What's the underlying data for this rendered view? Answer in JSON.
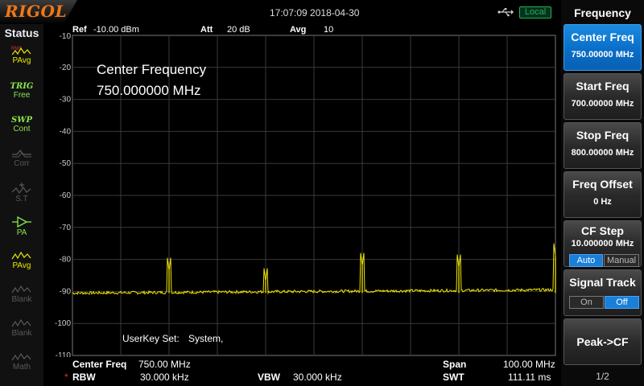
{
  "header": {
    "brand": "RIGOL",
    "datetime": "17:07:09 2018-04-30",
    "remote_badge": "Local",
    "usb_icon": "usb-icon"
  },
  "status_panel": {
    "title": "Status",
    "items": [
      {
        "id": "pavg",
        "tag": "",
        "label": "PAvg",
        "state": "active",
        "icon": "average-trace-icon"
      },
      {
        "id": "trig",
        "tag": "TRIG",
        "label": "Free",
        "state": "green",
        "icon": ""
      },
      {
        "id": "swp",
        "tag": "SWP",
        "label": "Cont",
        "state": "green",
        "icon": ""
      },
      {
        "id": "corr",
        "tag": "",
        "label": "Corr",
        "state": "dim",
        "icon": "correction-icon"
      },
      {
        "id": "st",
        "tag": "",
        "label": "S.T",
        "state": "dim",
        "icon": "spectrum-trace-icon"
      },
      {
        "id": "pa",
        "tag": "",
        "label": "PA",
        "state": "green",
        "icon": "preamp-icon"
      },
      {
        "id": "pavg2",
        "tag": "",
        "label": "PAvg",
        "state": "active",
        "icon": "average-trace-icon"
      },
      {
        "id": "blank1",
        "tag": "",
        "label": "Blank",
        "state": "dim",
        "icon": "trace-icon"
      },
      {
        "id": "blank2",
        "tag": "",
        "label": "Blank",
        "state": "dim",
        "icon": "trace-icon"
      },
      {
        "id": "math",
        "tag": "",
        "label": "Math",
        "state": "dim",
        "icon": "math-trace-icon"
      }
    ]
  },
  "plot": {
    "ref_label": "Ref",
    "ref_value": "-10.00 dBm",
    "att_label": "Att",
    "att_value": "20 dB",
    "avg_label": "Avg",
    "avg_value": "10",
    "marker_line1": "Center Frequency",
    "marker_line2": "750.000000 MHz",
    "userkey_label": "UserKey Set:",
    "userkey_value": "System,",
    "y_ticks": [
      "-10",
      "-20",
      "-30",
      "-40",
      "-50",
      "-60",
      "-70",
      "-80",
      "-90",
      "-100",
      "-110"
    ],
    "trace_color": "#f2e600",
    "grid_color": "#3a3a3a"
  },
  "chart_data": {
    "type": "line",
    "ylabel_unit": "dBm",
    "ylim": [
      -110,
      -10
    ],
    "xlim": [
      700,
      800
    ],
    "grid": true,
    "noise_floor_dbm": -90.5,
    "noise_floor_end_dbm": -89.5,
    "peaks": [
      {
        "x": 720,
        "y": -83.5
      },
      {
        "x": 740,
        "y": -86.8
      },
      {
        "x": 760,
        "y": -82
      },
      {
        "x": 780,
        "y": -82.5
      },
      {
        "x": 800,
        "y": -79
      }
    ]
  },
  "footer": {
    "center_label": "Center Freq",
    "center_value": "750.00 MHz",
    "rbw_star": "*",
    "rbw_label": "RBW",
    "rbw_value": "30.000 kHz",
    "vbw_label": "VBW",
    "vbw_value": "30.000 kHz",
    "span_label": "Span",
    "span_value": "100.00 MHz",
    "swt_label": "SWT",
    "swt_value": "111.11 ms"
  },
  "menu": {
    "title": "Frequency",
    "center_freq": {
      "title": "Center Freq",
      "value": "750.00000 MHz"
    },
    "start_freq": {
      "title": "Start Freq",
      "value": "700.00000 MHz"
    },
    "stop_freq": {
      "title": "Stop Freq",
      "value": "800.00000 MHz"
    },
    "freq_offset": {
      "title": "Freq Offset",
      "value": "0 Hz"
    },
    "cf_step": {
      "title": "CF Step",
      "value": "10.000000 MHz",
      "auto": "Auto",
      "manual": "Manual",
      "selected": "Auto"
    },
    "signal_track": {
      "title": "Signal Track",
      "on": "On",
      "off": "Off",
      "selected": "Off"
    },
    "peak_to_cf": {
      "title": "Peak->CF"
    },
    "page": "1/2",
    "accent_color": "#1a8be0"
  }
}
